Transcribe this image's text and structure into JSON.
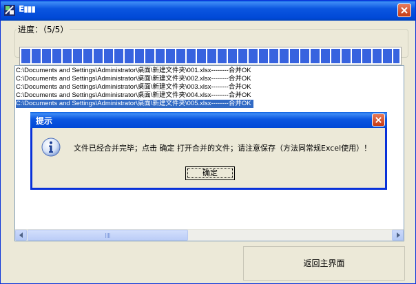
{
  "window": {
    "title": "E▮▮▮"
  },
  "progress": {
    "label": "进度：（5/5）",
    "fraction": 1.0
  },
  "log": {
    "lines": [
      "C:\\Documents and Settings\\Administrator\\桌面\\新建文件夹\\001.xlsx--------合并OK",
      "C:\\Documents and Settings\\Administrator\\桌面\\新建文件夹\\002.xlsx--------合并OK",
      "C:\\Documents and Settings\\Administrator\\桌面\\新建文件夹\\003.xlsx--------合并OK",
      "C:\\Documents and Settings\\Administrator\\桌面\\新建文件夹\\004.xlsx--------合并OK",
      "C:\\Documents and Settings\\Administrator\\桌面\\新建文件夹\\005.xlsx--------合并OK"
    ],
    "selected_index": 4
  },
  "buttons": {
    "return_label": "返回主界面"
  },
  "dialog": {
    "title": "提示",
    "message": "文件已经合并完毕；点击 确定 打开合并的文件；请注意保存（方法同常规Excel使用）！",
    "ok_label": "确定",
    "icon": "info-icon"
  },
  "colors": {
    "titlebar": "#0054e3",
    "progress": "#3763df",
    "selection": "#316ac5",
    "close": "#d5532d"
  }
}
